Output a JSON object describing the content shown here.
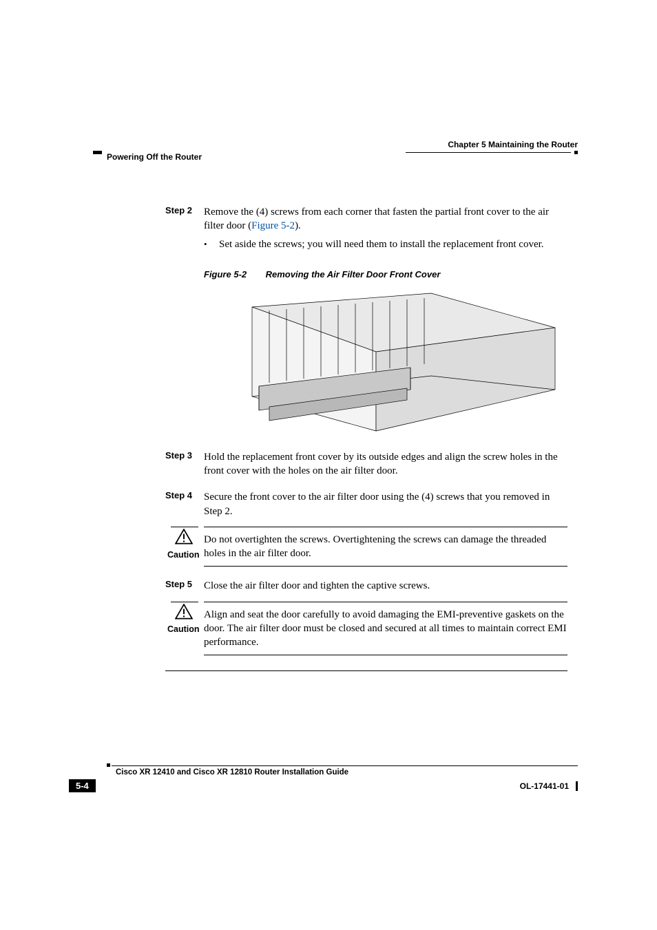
{
  "header": {
    "chapter": "Chapter 5      Maintaining the Router",
    "section": "Powering Off the Router"
  },
  "steps": {
    "s2": {
      "label": "Step 2",
      "text_a": "Remove the (4) screws from each corner that fasten the partial front cover to the air filter door (",
      "link": "Figure 5-2",
      "text_b": ").",
      "bullet": "Set aside the screws; you will need them to install the replacement front cover."
    },
    "figure": {
      "num": "Figure 5-2",
      "title": "Removing the Air Filter Door Front Cover"
    },
    "s3": {
      "label": "Step 3",
      "text": "Hold the replacement front cover by its outside edges and align the screw holes in the front cover with the holes on the air filter door."
    },
    "s4": {
      "label": "Step 4",
      "text": "Secure the front cover to the air filter door using the (4) screws that you removed in Step  2."
    },
    "caution1": {
      "label": "Caution",
      "text": "Do not overtighten the screws. Overtightening the screws can damage the threaded holes in the air filter door."
    },
    "s5": {
      "label": "Step 5",
      "text": "Close the air filter door and tighten the captive screws."
    },
    "caution2": {
      "label": "Caution",
      "text": "Align and seat the door carefully to avoid damaging the EMI-preventive gaskets on the door. The air filter door must be closed and secured at all times to maintain correct EMI performance."
    }
  },
  "footer": {
    "guide": "Cisco XR 12410 and Cisco XR 12810 Router Installation Guide",
    "page": "5-4",
    "docid": "OL-17441-01"
  }
}
